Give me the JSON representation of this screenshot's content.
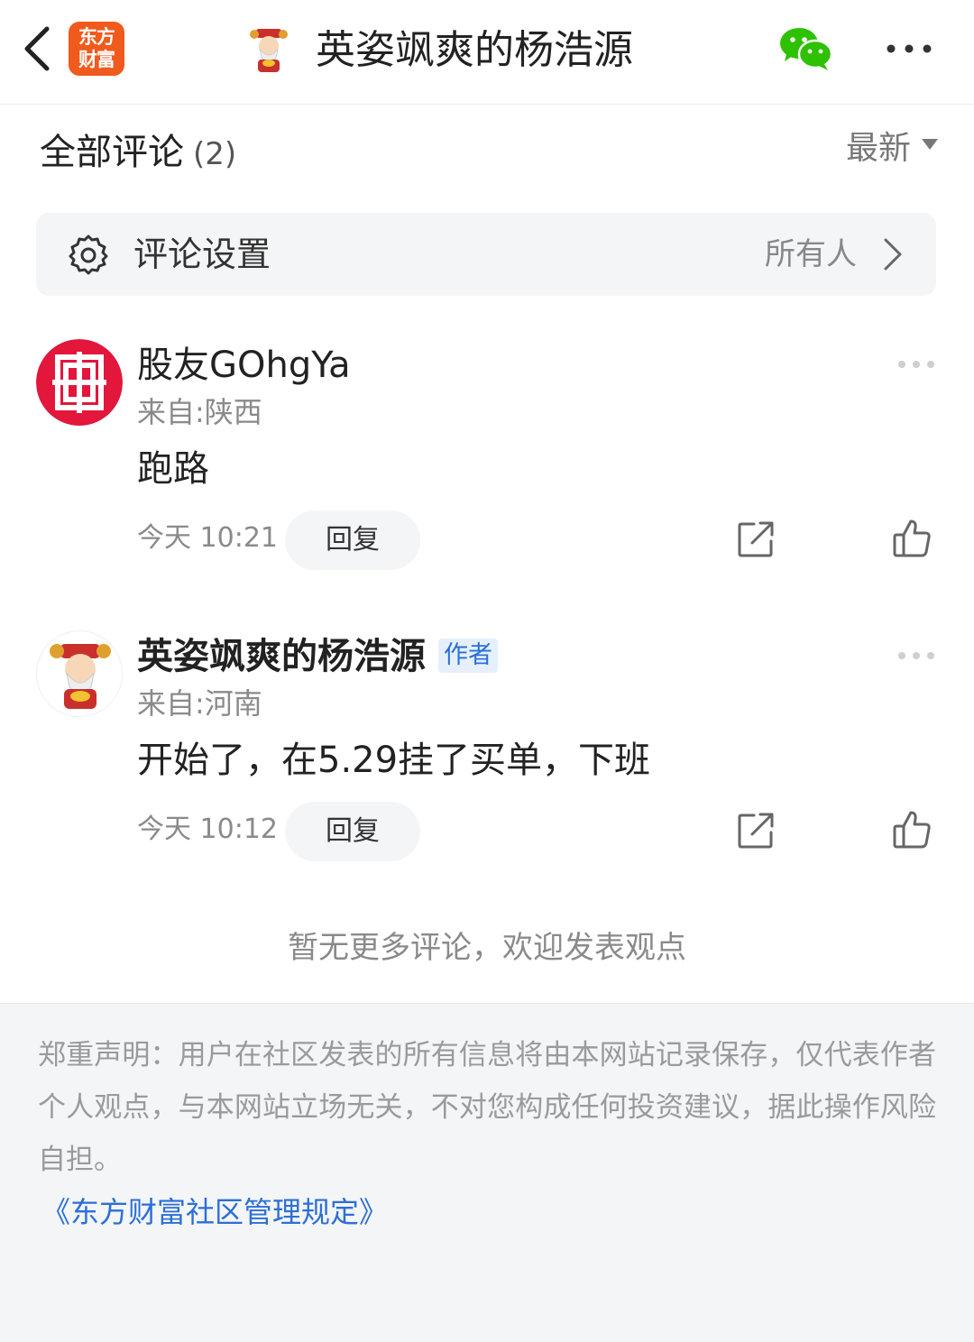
{
  "header": {
    "logo_line1": "东方",
    "logo_line2": "财富",
    "title": "英姿飒爽的杨浩源"
  },
  "comments_section": {
    "title": "全部评论",
    "count": "(2)",
    "sort_label": "最新"
  },
  "settings": {
    "label": "评论设置",
    "value": "所有人"
  },
  "comments": [
    {
      "username": "股友GOhgYa",
      "location": "来自:陕西",
      "text": "跑路",
      "time": "今天 10:21",
      "reply_label": "回复"
    },
    {
      "username": "英姿飒爽的杨浩源",
      "badge": "作者",
      "location": "来自:河南",
      "text": "开始了，在5.29挂了买单，下班",
      "time": "今天 10:12",
      "reply_label": "回复"
    }
  ],
  "no_more_text": "暂无更多评论，欢迎发表观点",
  "footer": {
    "disclaimer": "郑重声明：用户在社区发表的所有信息将由本网站记录保存，仅代表作者个人观点，与本网站立场无关，不对您构成任何投资建议，据此操作风险自担。",
    "rules_link": "《东方财富社区管理规定》"
  },
  "colors": {
    "logo_orange": "#f05a1c",
    "link_blue": "#2b6fd6",
    "wechat_green": "#2dc100",
    "avatar_red": "#e3163b"
  },
  "icons": [
    "back-arrow-icon",
    "wechat-icon",
    "more-icon",
    "gear-icon",
    "chevron-right-icon",
    "share-icon",
    "thumbs-up-icon",
    "sort-triangle-icon"
  ]
}
